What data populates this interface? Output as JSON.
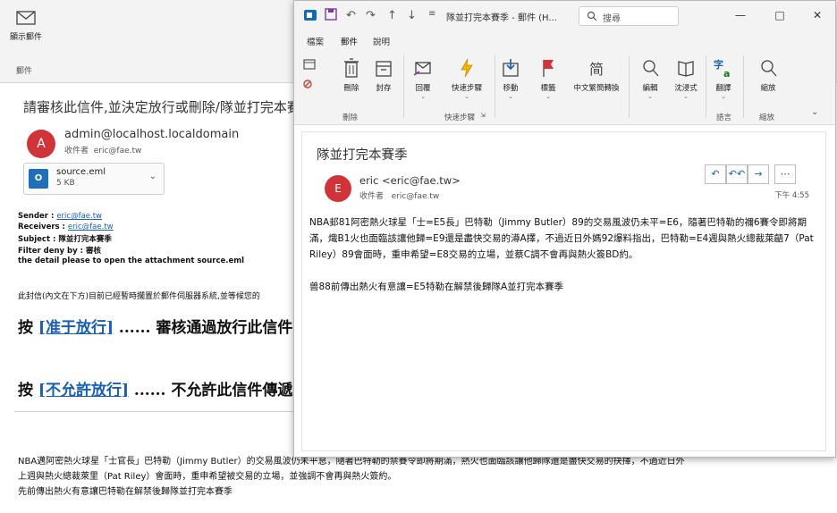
{
  "background_window": {
    "ribbon": {
      "show_mail_label": "顯示郵件",
      "group_label": "郵件"
    },
    "message": {
      "subject": "請審核此信件,並決定放行或刪除/隊並打完本賽季",
      "sender": "admin@localhost.localdomain",
      "to_label": "收件者",
      "to": "eric@fae.tw",
      "attachment": {
        "name": "source.eml",
        "size": "5 KB"
      },
      "details": {
        "sender_label": "Sender :",
        "sender_value": "eric@fae.tw",
        "receivers_label": "Receivers :",
        "receivers_value": "eric@fae.tw",
        "subject_line": "Subject : 隊並打完本賽季",
        "filter_line": "Filter deny by : 審核",
        "detail_line": "the detail please to open the attachment source.eml"
      },
      "notice": "此封信(內文在下方)目前已經暫時擱置於郵件伺服器系統,並等候您的",
      "approve": {
        "prefix": "按 ",
        "link": "[准于放行]",
        "suffix": " ...... 審核通過放行此信件"
      },
      "deny": {
        "prefix": "按 ",
        "link": "[不允許放行]",
        "suffix": " ...... 不允許此信件傳遞"
      },
      "body_lines": [
        "NBA邁阿密熱火球星「士官長」巴特勒（Jimmy Butler）的交易風波仍未平息，隨著巴特勒的禁賽令即將期滿，熱火也面臨該讓他歸隊還是盡快交易的抉擇，不過近日外",
        "上週與熱火總裁萊里（Pat Riley）會面時，重申希望被交易的立場，並強調不會再與熱火簽約。",
        "先前傳出熱火有意讓巴特勒在解禁後歸隊並打完本賽季"
      ]
    }
  },
  "foreground_window": {
    "title": "隊並打完本賽季 - 郵件 (H...",
    "search_placeholder": "搜尋",
    "tabs": [
      "檔案",
      "郵件",
      "說明"
    ],
    "ribbon": {
      "buttons": {
        "delete": "刪除",
        "archive": "封存",
        "reply": "回覆",
        "quick_steps": "快速步驟",
        "move": "移動",
        "tags": "標籤",
        "chinese_convert": "中文繁簡轉換",
        "edit": "編輯",
        "immersive": "沈浸式",
        "translate": "翻譯",
        "zoom": "縮放"
      },
      "groups": {
        "delete": "刪除",
        "quick_steps": "快速步驟",
        "language": "語言",
        "zoom": "縮放"
      }
    },
    "message": {
      "subject": "隊並打完本賽季",
      "sender": "eric <eric@fae.tw>",
      "to_label": "收件者",
      "to": "eric@fae.tw",
      "time": "下午 4:55",
      "avatar_letter": "E",
      "paragraphs": [
        "NBA邽81阿密熱火球星「士=E5長」巴特勒（Jimmy Butler）89的交易風波仍未平=E6，隨著巴特勒的禰6賽令即將期滿，熾B1火也面臨該讓他歸=E9還是盡快交易的澊A擇，不過近日外媽92爆料指出，巴特勒=E4週與熱火總裁萊齬7（Pat Riley）89會面時，重申希望=E8交易的立場，並蔡C調不會再與熱火簽BD約。",
        "兽88前傳出熱火有意讓=E5特勒在解禁後歸隊A並打完本賽季"
      ]
    }
  },
  "colors": {
    "accent": "#1a5fb4",
    "avatar": "#d13438",
    "outlook": "#0f6cbd"
  }
}
